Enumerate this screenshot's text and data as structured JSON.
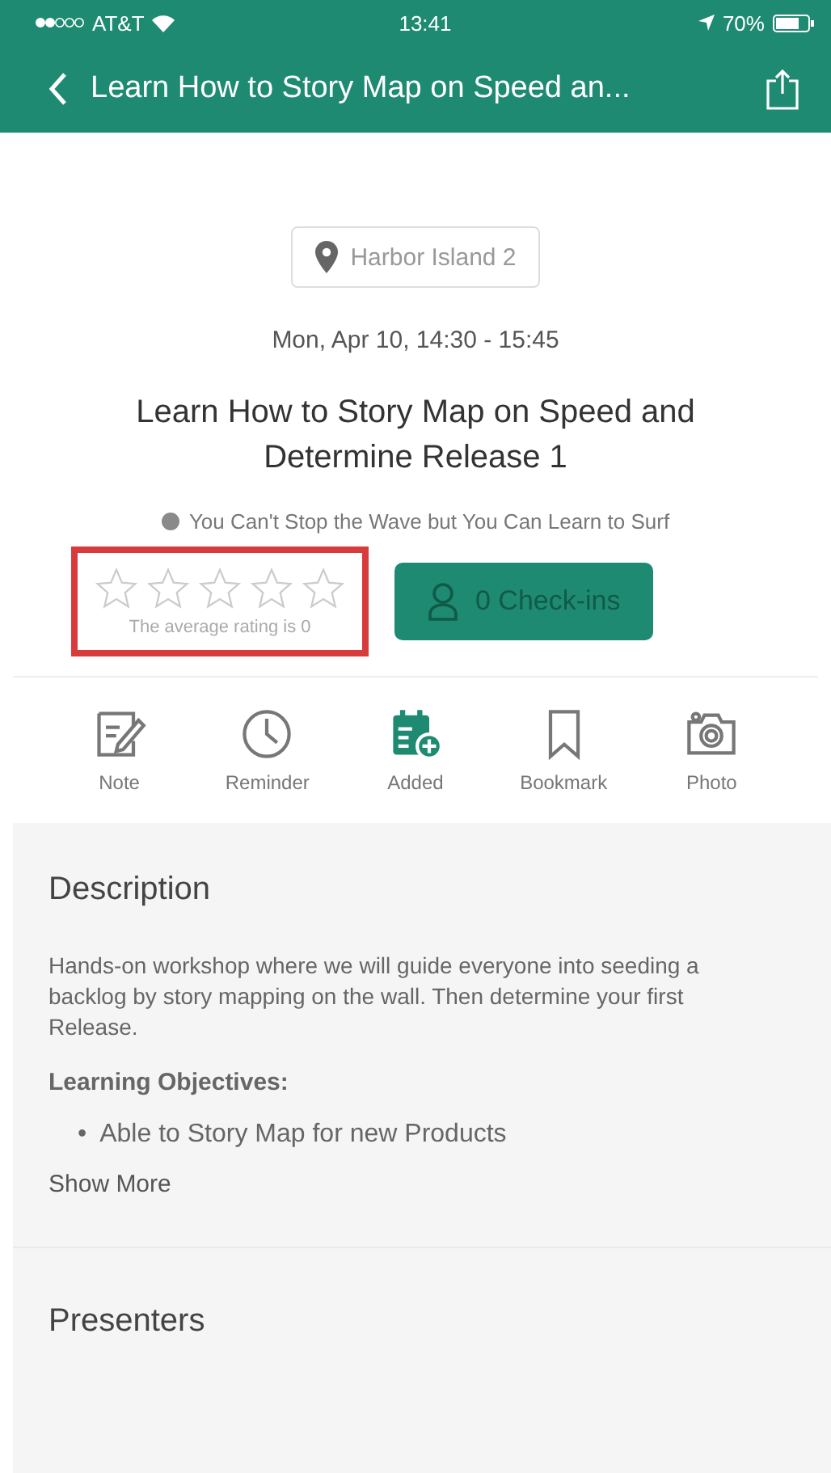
{
  "status_bar": {
    "carrier": "AT&T",
    "time": "13:41",
    "battery": "70%"
  },
  "nav_bar": {
    "title": "Learn How to Story Map on Speed an..."
  },
  "session": {
    "location": "Harbor Island 2",
    "datetime": "Mon, Apr 10, 14:30 - 15:45",
    "title": "Learn How to Story Map on Speed and Determine Release 1",
    "track": {
      "name": "You Can't Stop the Wave but You Can Learn to Surf",
      "color": "#8a8a8a"
    }
  },
  "rating": {
    "stars": 0,
    "caption": "The average rating is 0",
    "highlighted": true
  },
  "checkins_button": "0 Check-ins",
  "actions": [
    {
      "kind": "note",
      "label": "Note",
      "active": false
    },
    {
      "kind": "reminder",
      "label": "Reminder",
      "active": false
    },
    {
      "kind": "calendar",
      "label": "Added",
      "active": true
    },
    {
      "kind": "bookmark",
      "label": "Bookmark",
      "active": false
    },
    {
      "kind": "photo",
      "label": "Photo",
      "active": false
    }
  ],
  "description": {
    "heading": "Description",
    "text": "Hands-on workshop where we will guide everyone into seeding a backlog by story mapping on the wall. Then determine your first Release.",
    "objectives_heading": "Learning Objectives:",
    "objectives": [
      {
        "bullet": "•",
        "text": "Able to Story Map for new Products"
      }
    ],
    "show_more": "Show More"
  },
  "presenters": {
    "heading": "Presenters"
  }
}
